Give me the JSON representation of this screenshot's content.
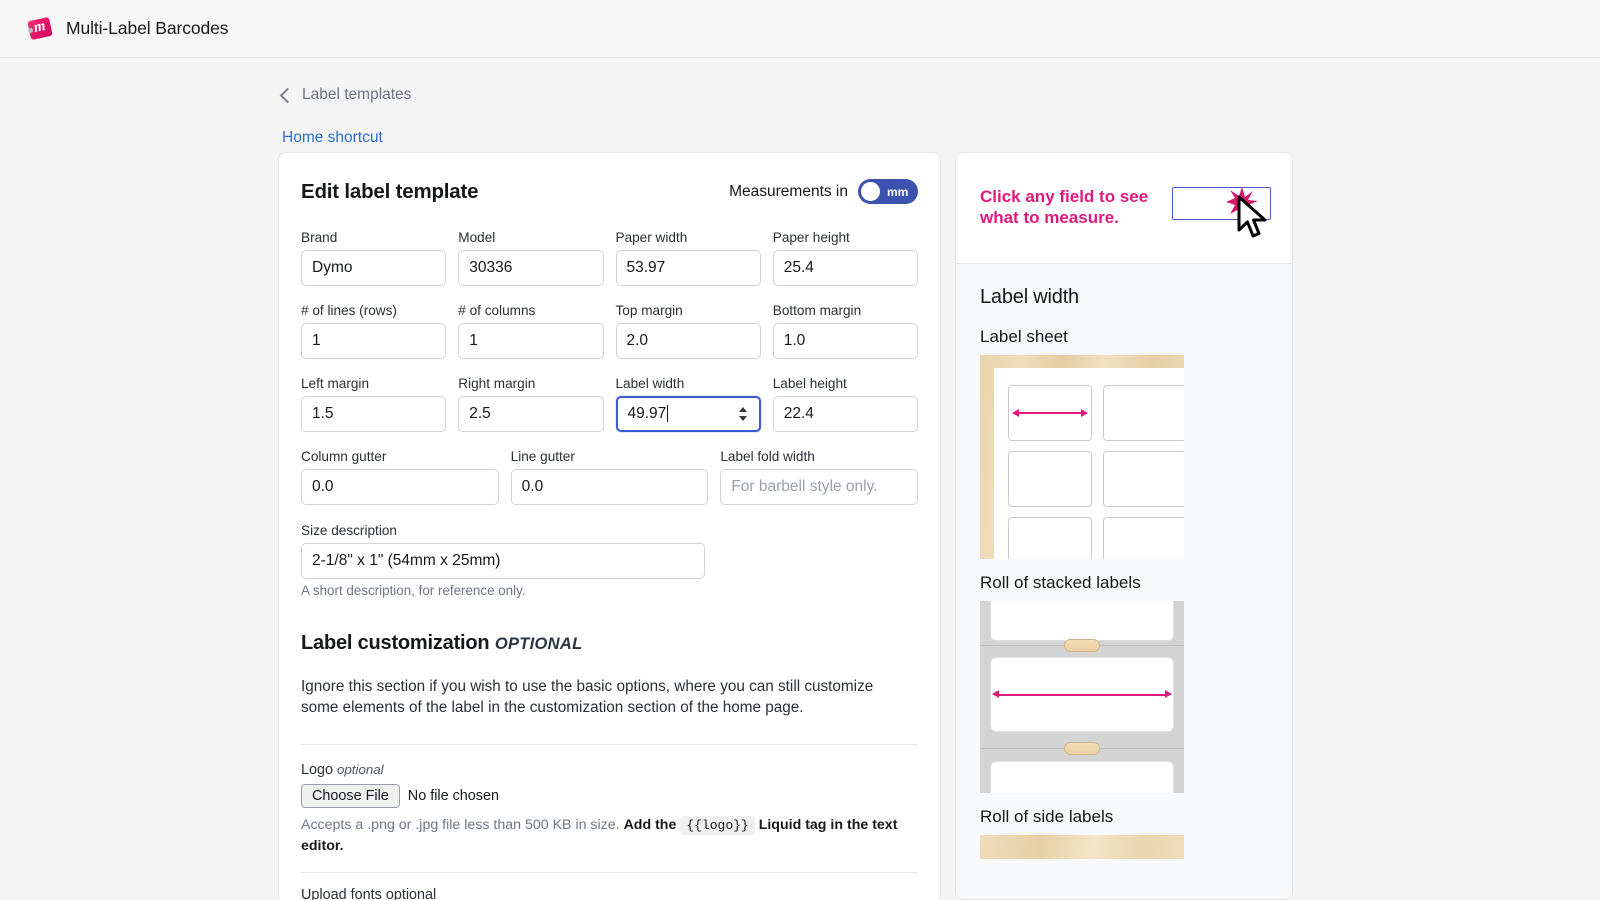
{
  "app": {
    "title": "Multi-Label Barcodes",
    "logo_icon": "price-tag-icon"
  },
  "nav": {
    "back_label": "Label templates",
    "back_icon": "chevron-left-icon",
    "home_shortcut": "Home shortcut"
  },
  "card": {
    "title": "Edit label template",
    "measurements_label": "Measurements in",
    "measurements_unit": "mm",
    "fields": [
      {
        "label": "Brand",
        "value": "Dymo",
        "placeholder": "",
        "focused": false
      },
      {
        "label": "Model",
        "value": "30336",
        "placeholder": "",
        "focused": false
      },
      {
        "label": "Paper width",
        "value": "53.97",
        "placeholder": "",
        "focused": false
      },
      {
        "label": "Paper height",
        "value": "25.4",
        "placeholder": "",
        "focused": false
      },
      {
        "label": "# of lines (rows)",
        "value": "1",
        "placeholder": "",
        "focused": false
      },
      {
        "label": "# of columns",
        "value": "1",
        "placeholder": "",
        "focused": false
      },
      {
        "label": "Top margin",
        "value": "2.0",
        "placeholder": "",
        "focused": false
      },
      {
        "label": "Bottom margin",
        "value": "1.0",
        "placeholder": "",
        "focused": false
      },
      {
        "label": "Left margin",
        "value": "1.5",
        "placeholder": "",
        "focused": false
      },
      {
        "label": "Right margin",
        "value": "2.5",
        "placeholder": "",
        "focused": false
      },
      {
        "label": "Label width",
        "value": "49.97",
        "placeholder": "",
        "focused": true
      },
      {
        "label": "Label height",
        "value": "22.4",
        "placeholder": "",
        "focused": false
      },
      {
        "label": "Column gutter",
        "value": "0.0",
        "placeholder": "",
        "focused": false
      },
      {
        "label": "Line gutter",
        "value": "0.0",
        "placeholder": "",
        "focused": false
      },
      {
        "label": "Label fold width",
        "value": "",
        "placeholder": "For barbell style only.",
        "focused": false
      }
    ],
    "size_description": {
      "label": "Size description",
      "value": "2-1/8\" x 1\" (54mm x 25mm)",
      "helper": "A short description, for reference only."
    },
    "customization": {
      "heading": "Label customization",
      "heading_optional": "OPTIONAL",
      "paragraph": "Ignore this section if you wish to use the basic options, where you can still customize some elements of the label in the customization section of the home page.",
      "logo": {
        "label": "Logo",
        "label_optional": "optional",
        "choose_button": "Choose File",
        "no_file": "No file chosen",
        "note_1": "Accepts a .png or .jpg file less than 500 KB in size.",
        "note_bold_1": "Add the",
        "note_code": "{{logo}}",
        "note_bold_2": "Liquid tag in the text editor."
      },
      "fonts": {
        "label": "Upload fonts",
        "label_optional": "optional"
      }
    }
  },
  "side": {
    "hint": "Click any field to see what to measure.",
    "demo_burst_icon": "sparkle-burst-icon",
    "demo_cursor_icon": "mouse-pointer-icon",
    "measure_title": "Label width",
    "diagrams": [
      {
        "name": "Label sheet"
      },
      {
        "name": "Roll of stacked labels"
      },
      {
        "name": "Roll of side labels"
      }
    ]
  },
  "colors": {
    "accent_pink": "#e0197d",
    "toggle_blue": "#3b52ae",
    "focus_blue": "#3c5bd6",
    "link_blue": "#2c6ecb"
  }
}
